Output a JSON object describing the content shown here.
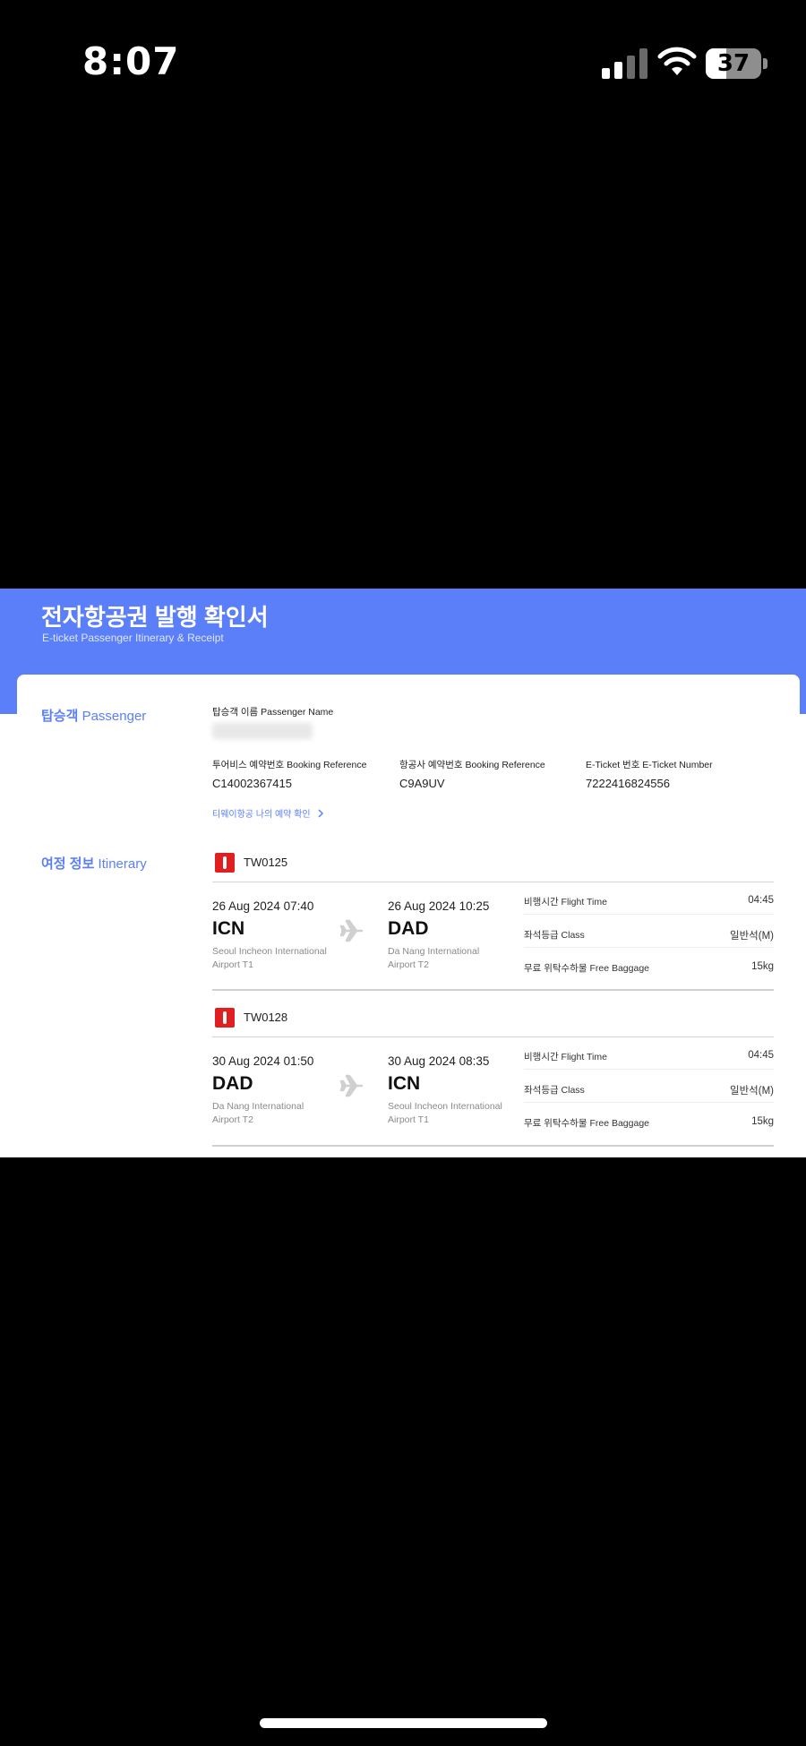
{
  "status_bar": {
    "time": "8:07",
    "battery_level": "37",
    "battery_fraction": 0.37
  },
  "document": {
    "title": "전자항공권 발행 확인서",
    "subtitle": "E-ticket Passenger Itinerary & Receipt",
    "passenger_section": {
      "label_ko": "탑승객",
      "label_en": "Passenger"
    },
    "passenger_name_label": "탑승객 이름 Passenger Name",
    "booking": [
      {
        "label": "투어비스 예약번호 Booking Reference",
        "value": "C14002367415"
      },
      {
        "label": "항공사 예약번호 Booking Reference",
        "value": "C9A9UV"
      },
      {
        "label": "E-Ticket 번호 E-Ticket Number",
        "value": "7222416824556"
      }
    ],
    "link": "티웨이항공 나의 예약 확인",
    "itinerary_section": {
      "label_ko": "여정 정보",
      "label_en": "Itinerary"
    },
    "flights": [
      {
        "flight_no": "TW0125",
        "dep_datetime": "26 Aug 2024 07:40",
        "dep_code": "ICN",
        "dep_airport_1": "Seoul Incheon International",
        "dep_airport_2": "Airport T1",
        "arr_datetime": "26 Aug 2024 10:25",
        "arr_code": "DAD",
        "arr_airport_1": "Da Nang International",
        "arr_airport_2": "Airport T2",
        "flight_time_label": "비행시간 Flight Time",
        "flight_time": "04:45",
        "class_label": "좌석등급 Class",
        "class": "일반석(M)",
        "baggage_label": "무료 위탁수하물 Free Baggage",
        "baggage": "15kg"
      },
      {
        "flight_no": "TW0128",
        "dep_datetime": "30 Aug 2024 01:50",
        "dep_code": "DAD",
        "dep_airport_1": "Da Nang International",
        "dep_airport_2": "Airport T2",
        "arr_datetime": "30 Aug 2024 08:35",
        "arr_code": "ICN",
        "arr_airport_1": "Seoul Incheon International",
        "arr_airport_2": "Airport T1",
        "flight_time_label": "비행시간 Flight Time",
        "flight_time": "04:45",
        "class_label": "좌석등급 Class",
        "class": "일반석(M)",
        "baggage_label": "무료 위탁수하물 Free Baggage",
        "baggage": "15kg"
      }
    ]
  },
  "colors": {
    "accent": "#5b7ff9",
    "airline": "#e02020"
  }
}
